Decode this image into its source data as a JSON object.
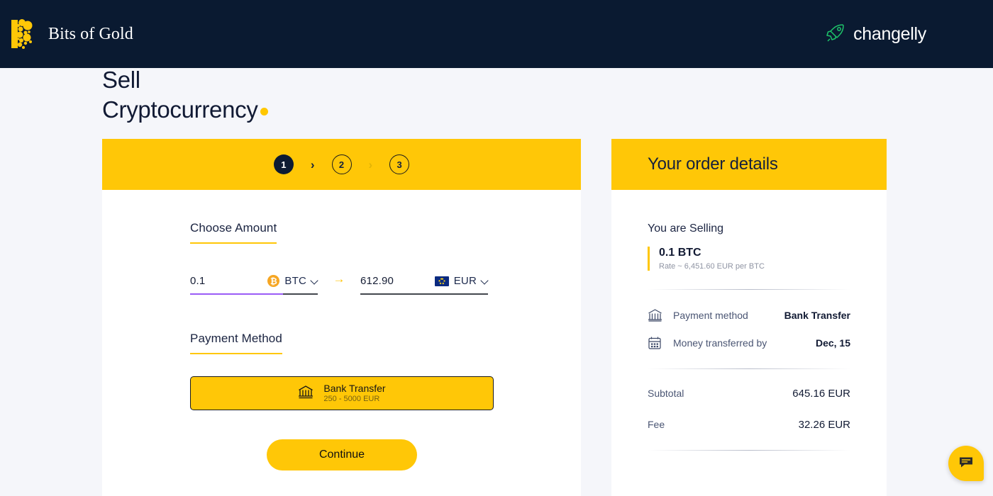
{
  "header": {
    "brand_name": "Bits of Gold",
    "brand_logo_icon": "bits-of-gold-dots-logo",
    "partner_name": "changelly",
    "partner_icon": "rocket-icon",
    "navy": "#0a1a31"
  },
  "page": {
    "title": "Sell\nCryptocurrency",
    "accent": "#ffc707",
    "background": "#f5f6fa"
  },
  "steps": {
    "items": [
      {
        "label": "1",
        "state": "active"
      },
      {
        "label": "2",
        "state": "idle"
      },
      {
        "label": "3",
        "state": "idle"
      }
    ],
    "separator": "›"
  },
  "form": {
    "amount_section_label": "Choose Amount",
    "from": {
      "value": "0.1",
      "placeholder": "0.00",
      "currency": "BTC",
      "icon": "bitcoin-icon",
      "chevron": "chevron-down-icon"
    },
    "swap_icon": "arrow-right-icon",
    "to": {
      "value": "612.90",
      "placeholder": "0.00",
      "currency": "EUR",
      "icon": "eu-flag-icon",
      "chevron": "chevron-down-icon"
    },
    "payment_section_label": "Payment Method",
    "payment_option": {
      "icon": "bank-icon",
      "title": "Bank Transfer",
      "limits": "250 - 5000 EUR"
    },
    "continue_label": "Continue"
  },
  "order": {
    "title": "Your order details",
    "selling_label": "You are Selling",
    "selling_amount": "0.1 BTC",
    "selling_rate": "Rate ~ 6,451.60 EUR per BTC",
    "rows": [
      {
        "icon": "bank-icon",
        "key": "Payment method",
        "value": "Bank Transfer"
      },
      {
        "icon": "calendar-icon",
        "key": "Money transferred by",
        "value": "Dec, 15"
      }
    ],
    "summary": [
      {
        "key": "Subtotal",
        "value": "645.16 EUR"
      },
      {
        "key": "Fee",
        "value": "32.26 EUR"
      }
    ]
  },
  "chat": {
    "icon": "chat-bubble-icon"
  }
}
